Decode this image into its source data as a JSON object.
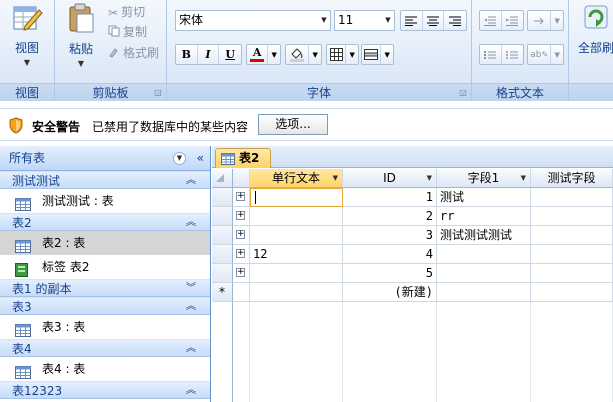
{
  "ribbon": {
    "view": {
      "label": "视图",
      "group_label": "视图"
    },
    "clipboard": {
      "paste_label": "粘贴",
      "cut_label": "剪切",
      "copy_label": "复制",
      "format_painter_label": "格式刷",
      "group_label": "剪贴板"
    },
    "font": {
      "font_name": "宋体",
      "font_size": "11",
      "bold": "B",
      "italic": "I",
      "underline": "U",
      "font_color_glyph": "A",
      "group_label": "字体"
    },
    "rich_text": {
      "group_label": "格式文本"
    },
    "records": {
      "refresh_label": "全部刷"
    }
  },
  "security": {
    "title": "安全警告",
    "message": "已禁用了数据库中的某些内容",
    "options_label": "选项..."
  },
  "nav": {
    "header": "所有表",
    "groups": [
      {
        "label": "测试测试",
        "items": [
          {
            "label": "测试测试 : 表",
            "icon": "table-icon",
            "selected": false
          }
        ],
        "chevron": "up"
      },
      {
        "label": "表2",
        "items": [
          {
            "label": "表2 : 表",
            "icon": "table-icon",
            "selected": true
          },
          {
            "label": "标签 表2",
            "icon": "report-icon",
            "selected": false
          }
        ],
        "chevron": "up"
      },
      {
        "label": "表1 的副本",
        "items": [],
        "chevron": "down"
      },
      {
        "label": "表3",
        "items": [
          {
            "label": "表3 : 表",
            "icon": "table-icon",
            "selected": false
          }
        ],
        "chevron": "up"
      },
      {
        "label": "表4",
        "items": [
          {
            "label": "表4 : 表",
            "icon": "table-icon",
            "selected": false
          }
        ],
        "chevron": "up"
      },
      {
        "label": "表12323",
        "items": [],
        "chevron": "up"
      }
    ]
  },
  "doc": {
    "tab_label": "表2",
    "columns": [
      "单行文本",
      "ID",
      "字段1",
      "测试字段"
    ],
    "rows": [
      {
        "text": "",
        "id": "1",
        "field1": "测试",
        "test": ""
      },
      {
        "text": "",
        "id": "2",
        "field1": "rr",
        "test": ""
      },
      {
        "text": "",
        "id": "3",
        "field1": "测试测试测试",
        "test": ""
      },
      {
        "text": "12",
        "id": "4",
        "field1": "",
        "test": ""
      },
      {
        "text": "",
        "id": "5",
        "field1": "",
        "test": ""
      }
    ],
    "new_row_marker": "*",
    "new_row_label": "(新建)"
  },
  "colors": {
    "ribbon_bg": "#dbe8f7",
    "sorted_header": "#ffd46a",
    "tab_active": "#ffd264",
    "nav_selected": "#d5d5d5"
  }
}
